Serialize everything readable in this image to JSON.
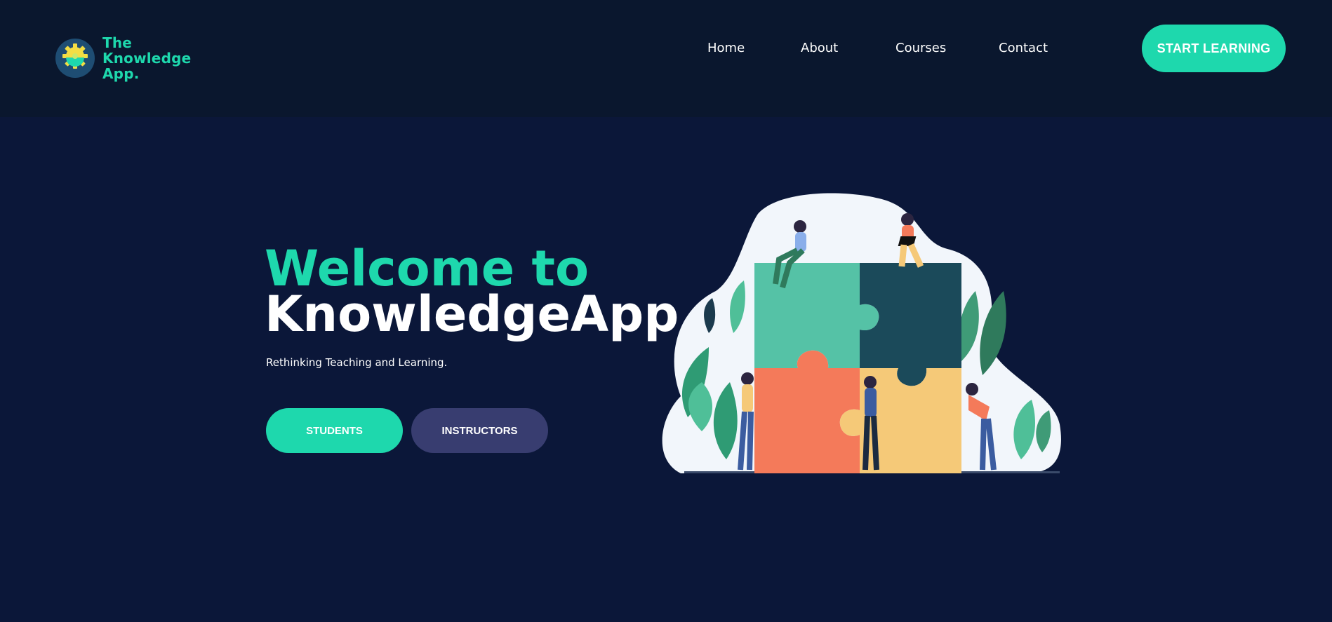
{
  "brand": {
    "line1": "The",
    "line2": "Knowledge",
    "line3": "App."
  },
  "nav": {
    "items": [
      {
        "label": "Home"
      },
      {
        "label": "About"
      },
      {
        "label": "Courses"
      },
      {
        "label": "Contact"
      }
    ]
  },
  "header": {
    "cta_label": "START LEARNING"
  },
  "hero": {
    "title_line1": "Welcome to",
    "title_line2": "KnowledgeApp",
    "subtitle": "Rethinking Teaching and Learning.",
    "buttons": {
      "students": "STUDENTS",
      "instructors": "INSTRUCTORS"
    }
  },
  "colors": {
    "accent": "#1ed8ad",
    "background": "#0b1739",
    "header_bg": "#0a172e",
    "secondary_button": "#383d70"
  },
  "icons": {
    "logo": "gear-brain-icon",
    "illustration": "puzzle-team-illustration"
  }
}
